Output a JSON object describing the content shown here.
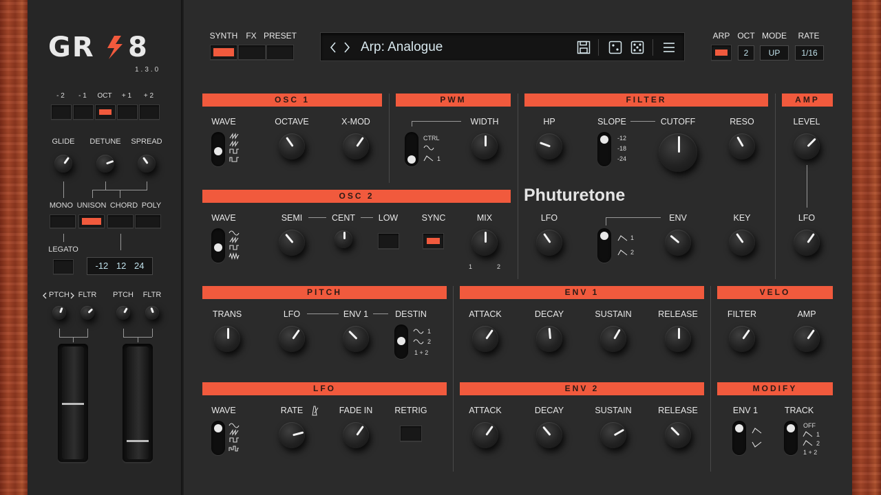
{
  "brand": {
    "logo": "GR-8",
    "version": "1.3.0"
  },
  "top": {
    "tabs": [
      "SYNTH",
      "FX",
      "PRESET"
    ],
    "preset_name": "Arp: Analogue",
    "arp_labels": [
      "ARP",
      "OCT",
      "MODE",
      "RATE"
    ],
    "arp_oct": "2",
    "arp_mode": "UP",
    "arp_rate": "1/16"
  },
  "left": {
    "oct_labels": [
      "- 2",
      "- 1",
      "OCT",
      "+ 1",
      "+ 2"
    ],
    "knob_labels": [
      "GLIDE",
      "DETUNE",
      "SPREAD"
    ],
    "voice_labels": [
      "MONO",
      "UNISON",
      "CHORD",
      "POLY"
    ],
    "legato": "LEGATO",
    "chord_values": [
      "-12",
      "12",
      "24"
    ],
    "bend_labels": [
      "PTCH",
      "FLTR",
      "PTCH",
      "FLTR"
    ]
  },
  "osc1": {
    "title": "OSC 1",
    "labels": [
      "WAVE",
      "OCTAVE",
      "X-MOD"
    ]
  },
  "pwm": {
    "title": "PWM",
    "ctrl": "CTRL",
    "one": "1",
    "width": "WIDTH"
  },
  "filter": {
    "title": "FILTER",
    "labels": [
      "HP",
      "SLOPE",
      "CUTOFF",
      "RESO"
    ],
    "slopes": [
      "-12",
      "-18",
      "-24"
    ],
    "labels2": [
      "LFO",
      "ENV",
      "KEY"
    ],
    "env_opts": [
      "1",
      "2"
    ]
  },
  "amp": {
    "title": "AMP",
    "level": "LEVEL",
    "lfo": "LFO"
  },
  "osc2": {
    "title": "OSC 2",
    "labels": [
      "WAVE",
      "SEMI",
      "CENT",
      "LOW",
      "SYNC",
      "MIX"
    ],
    "mix_range": [
      "1",
      "2"
    ]
  },
  "watermark": "Phuturetone",
  "pitch": {
    "title": "PITCH",
    "labels": [
      "TRANS",
      "LFO",
      "ENV 1",
      "DESTIN"
    ],
    "destin_opts": [
      "1",
      "2",
      "1 + 2"
    ]
  },
  "env1": {
    "title": "ENV 1",
    "labels": [
      "ATTACK",
      "DECAY",
      "SUSTAIN",
      "RELEASE"
    ]
  },
  "velo": {
    "title": "VELO",
    "labels": [
      "FILTER",
      "AMP"
    ]
  },
  "lfo": {
    "title": "LFO",
    "labels": [
      "WAVE",
      "RATE",
      "FADE IN",
      "RETRIG"
    ]
  },
  "env2": {
    "title": "ENV 2",
    "labels": [
      "ATTACK",
      "DECAY",
      "SUSTAIN",
      "RELEASE"
    ]
  },
  "modify": {
    "title": "MODIFY",
    "labels": [
      "ENV 1",
      "TRACK"
    ],
    "track_opts": [
      "OFF",
      "1",
      "2",
      "1 + 2"
    ]
  },
  "colors": {
    "accent": "#f15a3d",
    "panel": "#2b2b2b",
    "display_text": "#bfe0ea"
  }
}
